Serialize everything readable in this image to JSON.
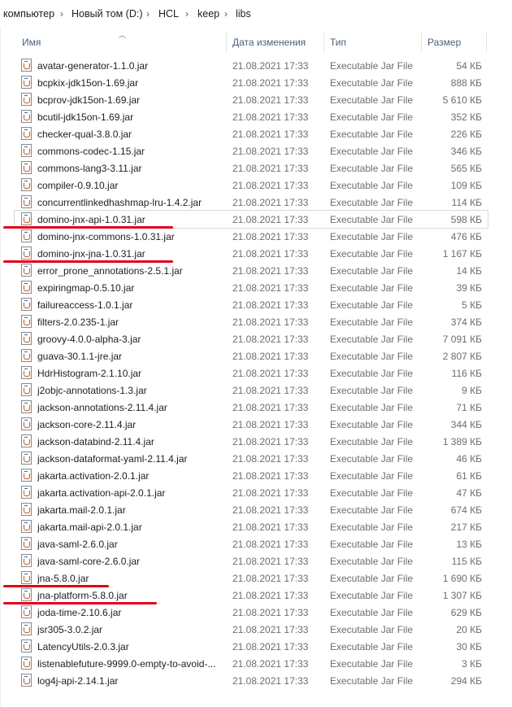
{
  "breadcrumb": [
    "компьютер",
    "Новый том (D:)",
    "HCL",
    "keep",
    "libs"
  ],
  "columns": {
    "name": "Имя",
    "date": "Дата изменения",
    "type": "Тип",
    "size": "Размер"
  },
  "colors": {
    "annotation": "#e2001a",
    "header_text": "#4c607a"
  },
  "files": [
    {
      "name": "avatar-generator-1.1.0.jar",
      "date": "21.08.2021 17:33",
      "type": "Executable Jar File",
      "size": "54 КБ"
    },
    {
      "name": "bcpkix-jdk15on-1.69.jar",
      "date": "21.08.2021 17:33",
      "type": "Executable Jar File",
      "size": "888 КБ"
    },
    {
      "name": "bcprov-jdk15on-1.69.jar",
      "date": "21.08.2021 17:33",
      "type": "Executable Jar File",
      "size": "5 610 КБ"
    },
    {
      "name": "bcutil-jdk15on-1.69.jar",
      "date": "21.08.2021 17:33",
      "type": "Executable Jar File",
      "size": "352 КБ"
    },
    {
      "name": "checker-qual-3.8.0.jar",
      "date": "21.08.2021 17:33",
      "type": "Executable Jar File",
      "size": "226 КБ"
    },
    {
      "name": "commons-codec-1.15.jar",
      "date": "21.08.2021 17:33",
      "type": "Executable Jar File",
      "size": "346 КБ"
    },
    {
      "name": "commons-lang3-3.11.jar",
      "date": "21.08.2021 17:33",
      "type": "Executable Jar File",
      "size": "565 КБ"
    },
    {
      "name": "compiler-0.9.10.jar",
      "date": "21.08.2021 17:33",
      "type": "Executable Jar File",
      "size": "109 КБ"
    },
    {
      "name": "concurrentlinkedhashmap-lru-1.4.2.jar",
      "date": "21.08.2021 17:33",
      "type": "Executable Jar File",
      "size": "114 КБ"
    },
    {
      "name": "domino-jnx-api-1.0.31.jar",
      "date": "21.08.2021 17:33",
      "type": "Executable Jar File",
      "size": "598 КБ",
      "selected": true,
      "underlined": true
    },
    {
      "name": "domino-jnx-commons-1.0.31.jar",
      "date": "21.08.2021 17:33",
      "type": "Executable Jar File",
      "size": "476 КБ"
    },
    {
      "name": "domino-jnx-jna-1.0.31.jar",
      "date": "21.08.2021 17:33",
      "type": "Executable Jar File",
      "size": "1 167 КБ",
      "underlined": true
    },
    {
      "name": "error_prone_annotations-2.5.1.jar",
      "date": "21.08.2021 17:33",
      "type": "Executable Jar File",
      "size": "14 КБ"
    },
    {
      "name": "expiringmap-0.5.10.jar",
      "date": "21.08.2021 17:33",
      "type": "Executable Jar File",
      "size": "39 КБ"
    },
    {
      "name": "failureaccess-1.0.1.jar",
      "date": "21.08.2021 17:33",
      "type": "Executable Jar File",
      "size": "5 КБ"
    },
    {
      "name": "filters-2.0.235-1.jar",
      "date": "21.08.2021 17:33",
      "type": "Executable Jar File",
      "size": "374 КБ"
    },
    {
      "name": "groovy-4.0.0-alpha-3.jar",
      "date": "21.08.2021 17:33",
      "type": "Executable Jar File",
      "size": "7 091 КБ"
    },
    {
      "name": "guava-30.1.1-jre.jar",
      "date": "21.08.2021 17:33",
      "type": "Executable Jar File",
      "size": "2 807 КБ"
    },
    {
      "name": "HdrHistogram-2.1.10.jar",
      "date": "21.08.2021 17:33",
      "type": "Executable Jar File",
      "size": "116 КБ"
    },
    {
      "name": "j2objc-annotations-1.3.jar",
      "date": "21.08.2021 17:33",
      "type": "Executable Jar File",
      "size": "9 КБ"
    },
    {
      "name": "jackson-annotations-2.11.4.jar",
      "date": "21.08.2021 17:33",
      "type": "Executable Jar File",
      "size": "71 КБ"
    },
    {
      "name": "jackson-core-2.11.4.jar",
      "date": "21.08.2021 17:33",
      "type": "Executable Jar File",
      "size": "344 КБ"
    },
    {
      "name": "jackson-databind-2.11.4.jar",
      "date": "21.08.2021 17:33",
      "type": "Executable Jar File",
      "size": "1 389 КБ"
    },
    {
      "name": "jackson-dataformat-yaml-2.11.4.jar",
      "date": "21.08.2021 17:33",
      "type": "Executable Jar File",
      "size": "46 КБ"
    },
    {
      "name": "jakarta.activation-2.0.1.jar",
      "date": "21.08.2021 17:33",
      "type": "Executable Jar File",
      "size": "61 КБ"
    },
    {
      "name": "jakarta.activation-api-2.0.1.jar",
      "date": "21.08.2021 17:33",
      "type": "Executable Jar File",
      "size": "47 КБ"
    },
    {
      "name": "jakarta.mail-2.0.1.jar",
      "date": "21.08.2021 17:33",
      "type": "Executable Jar File",
      "size": "674 КБ"
    },
    {
      "name": "jakarta.mail-api-2.0.1.jar",
      "date": "21.08.2021 17:33",
      "type": "Executable Jar File",
      "size": "217 КБ"
    },
    {
      "name": "java-saml-2.6.0.jar",
      "date": "21.08.2021 17:33",
      "type": "Executable Jar File",
      "size": "13 КБ"
    },
    {
      "name": "java-saml-core-2.6.0.jar",
      "date": "21.08.2021 17:33",
      "type": "Executable Jar File",
      "size": "115 КБ"
    },
    {
      "name": "jna-5.8.0.jar",
      "date": "21.08.2021 17:33",
      "type": "Executable Jar File",
      "size": "1 690 КБ",
      "underlined": true
    },
    {
      "name": "jna-platform-5.8.0.jar",
      "date": "21.08.2021 17:33",
      "type": "Executable Jar File",
      "size": "1 307 КБ",
      "underlined": true
    },
    {
      "name": "joda-time-2.10.6.jar",
      "date": "21.08.2021 17:33",
      "type": "Executable Jar File",
      "size": "629 КБ"
    },
    {
      "name": "jsr305-3.0.2.jar",
      "date": "21.08.2021 17:33",
      "type": "Executable Jar File",
      "size": "20 КБ"
    },
    {
      "name": "LatencyUtils-2.0.3.jar",
      "date": "21.08.2021 17:33",
      "type": "Executable Jar File",
      "size": "30 КБ"
    },
    {
      "name": "listenablefuture-9999.0-empty-to-avoid-...",
      "date": "21.08.2021 17:33",
      "type": "Executable Jar File",
      "size": "3 КБ"
    },
    {
      "name": "log4j-api-2.14.1.jar",
      "date": "21.08.2021 17:33",
      "type": "Executable Jar File",
      "size": "294 КБ"
    }
  ]
}
